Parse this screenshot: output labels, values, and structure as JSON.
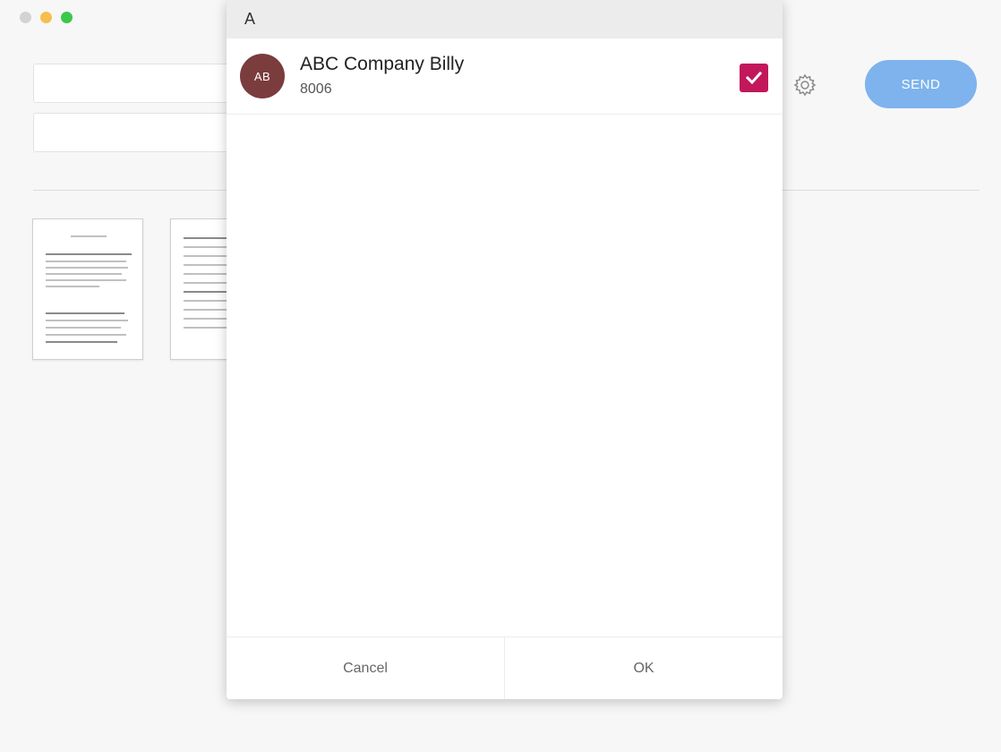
{
  "window": {
    "traffic_lights": [
      "close",
      "minimize",
      "maximize"
    ]
  },
  "background": {
    "send_label": "SEND",
    "settings_icon": "gear-icon",
    "accent_color": "#7eb3ee"
  },
  "dialog": {
    "section_letter": "A",
    "contacts": [
      {
        "initials": "AB",
        "name": "ABC Company Billy",
        "number": "8006",
        "checked": true
      }
    ],
    "cancel_label": "Cancel",
    "ok_label": "OK",
    "checkbox_color": "#c2185b",
    "avatar_color": "#7a3c3c"
  }
}
